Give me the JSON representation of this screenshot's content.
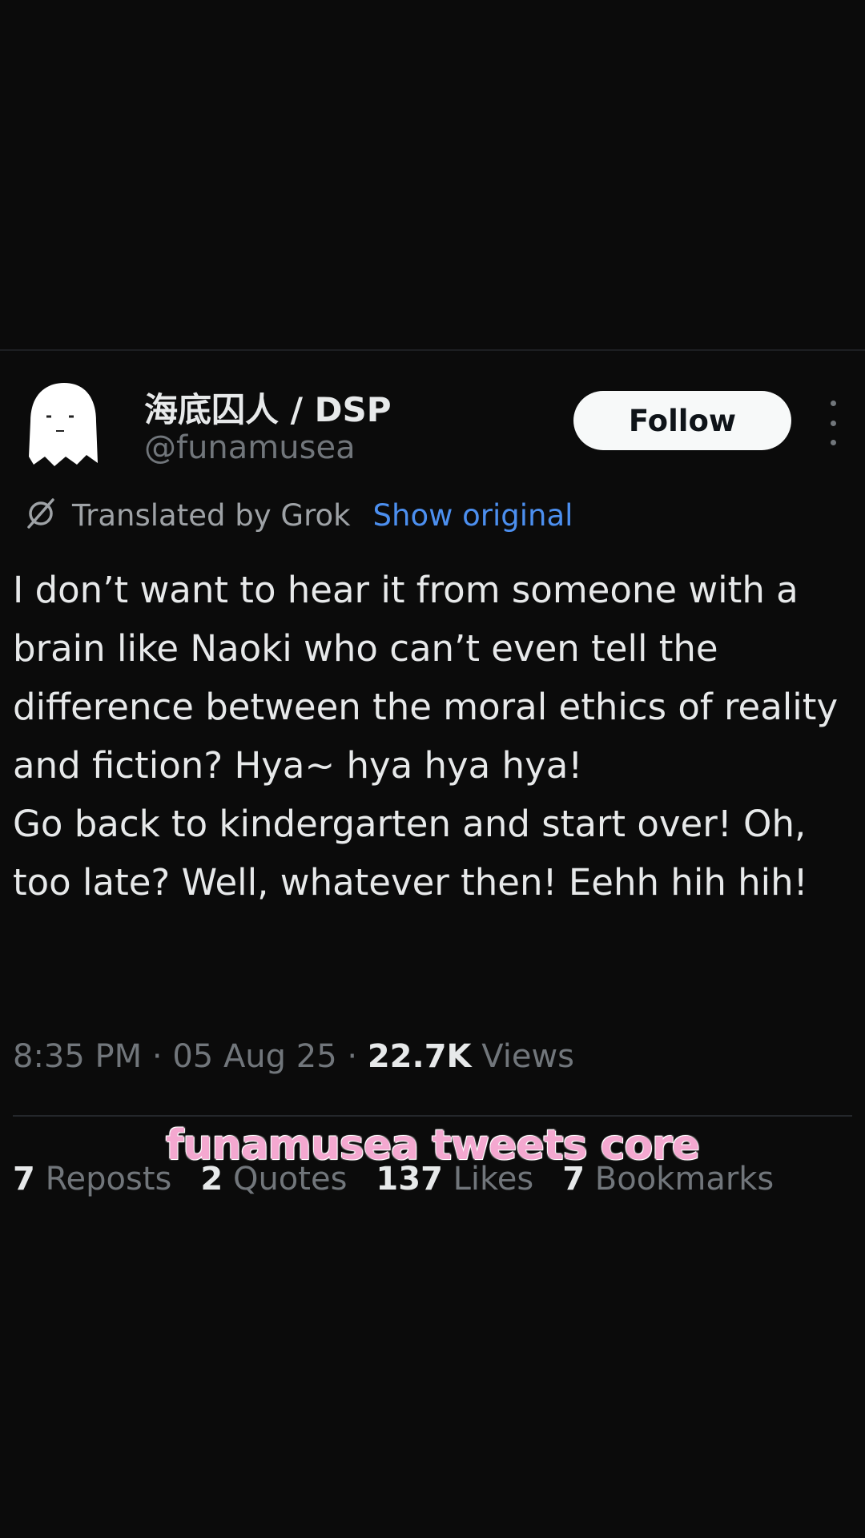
{
  "tweet": {
    "display_name": "海底囚人 / DSP",
    "handle": "@funamusea",
    "follow_label": "Follow",
    "translated_label": "Translated by Grok",
    "show_original_label": "Show original",
    "text": "I don’t want to hear it from someone with a brain like Naoki who can’t even tell the difference between the moral ethics of reality and fiction? Hya~ hya hya hya!\nGo back to kindergarten and start over! Oh, too late? Well, whatever then! Eehh hih hih!",
    "time": "8:35 PM",
    "date": "05 Aug 25",
    "views_count": "22.7K",
    "views_label": "Views",
    "stats": [
      {
        "count": "7",
        "label": "Reposts"
      },
      {
        "count": "2",
        "label": "Quotes"
      },
      {
        "count": "137",
        "label": "Likes"
      },
      {
        "count": "7",
        "label": "Bookmarks"
      }
    ]
  },
  "overlay": {
    "caption": "funamusea tweets core"
  },
  "icons": {
    "avatar": "ghost-avatar-icon",
    "translate": "translate-icon",
    "more": "more-options-icon"
  },
  "colors": {
    "background": "#0b0b0b",
    "link": "#4c8fef",
    "caption": "#f4a8d0"
  }
}
